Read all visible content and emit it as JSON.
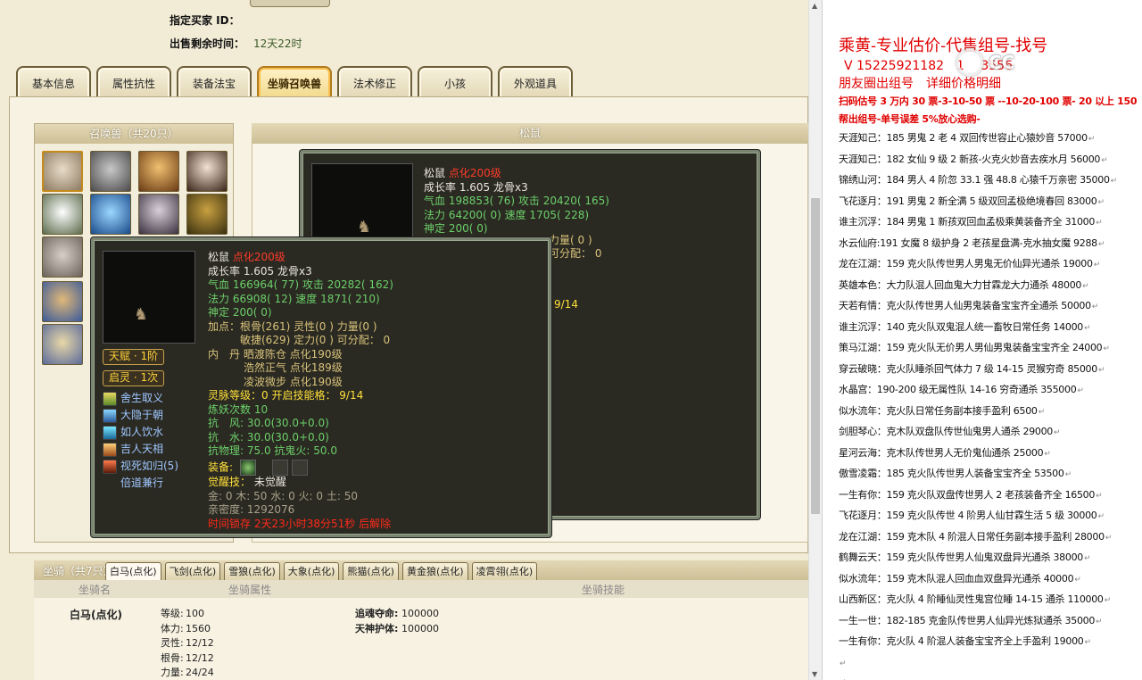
{
  "top_info": {
    "buyer_label": "指定买家 ID：",
    "time_label": "出售剩余时间：",
    "time_value": "12天22时"
  },
  "tabs": [
    "基本信息",
    "属性抗性",
    "装备法宝",
    "坐骑召唤兽",
    "法术修正",
    "小孩",
    "外观道具"
  ],
  "active_tab": "坐骑召唤兽",
  "pets_panel": {
    "title": "召唤兽（共20只）"
  },
  "right_panel": {
    "title": "松鼠"
  },
  "back_tooltip": {
    "name": "松鼠",
    "tag": "点化200级",
    "growth": "成长率 1.605  龙骨x3",
    "hp": "气血 198853( 76) 攻击 20420( 165)",
    "mp": "法力 64200( 0) 速度 1705( 228)",
    "spirit": "神定 200( 0)",
    "points_partial": "力量( 0 )",
    "free_partial": "可分配： 0",
    "frag1": "9/14"
  },
  "tooltip": {
    "name": "松鼠",
    "tag": "点化200级",
    "growth": "成长率 1.605  龙骨x3",
    "hp": "气血 166964( 77) 攻击 20282( 162)",
    "mp": "法力 66908( 12) 速度 1871( 210)",
    "spirit": "神定 200( 0)",
    "points1": "加点：根骨(261) 灵性(0 ) 力量(0 )",
    "points2": "敏捷(629) 定力(0 ) 可分配： 0",
    "dan_label": "内　丹",
    "dan1": "晒渡陈仓 点化190级",
    "dan2": "浩然正气 点化189级",
    "dan3": "凌波微步 点化190级",
    "soul_grade": "灵脉等级：0 开启技能格： 9/14",
    "train": "炼妖次数 10",
    "res_wind": "抗　风: 30.0(30.0+0.0)",
    "res_water": "抗　水: 30.0(30.0+0.0)",
    "res_phys": "抗物理: 75.0 抗鬼火: 50.0",
    "equip_label": "装备:",
    "awaken_label": "觉醒技：",
    "awaken_value": "未觉醒",
    "elements": "金: 0 木: 50 水: 0 火: 0 土: 50",
    "intimacy": "亲密度: 1292076",
    "lock_time": "时间锁存 2天23小时38分51秒 后解除",
    "badge1": "天赋 · 1阶",
    "badge2": "启灵 · 1次",
    "skills": [
      "舍生取义",
      "大隐于朝",
      "如人饮水",
      "吉人天相",
      "视死如归(5)",
      "倍道兼行"
    ]
  },
  "mount": {
    "title": "坐骑（共7只）",
    "tabs": [
      "白马(点化)",
      "飞剑(点化)",
      "雪狼(点化)",
      "大象(点化)",
      "熊猫(点化)",
      "黄金狼(点化)",
      "凌霄翎(点化)"
    ],
    "col_name": "坐骑名",
    "col_attr": "坐骑属性",
    "col_skill": "坐骑技能",
    "name": "白马(点化)",
    "attrs": [
      {
        "k": "等级:",
        "v": "100"
      },
      {
        "k": "体力:",
        "v": "1560"
      },
      {
        "k": "灵性:",
        "v": "12/12"
      },
      {
        "k": "根骨:",
        "v": "12/12"
      },
      {
        "k": "力量:",
        "v": "24/24"
      }
    ],
    "skills": [
      {
        "k": "追魂夺命:",
        "v": "100000"
      },
      {
        "k": "天神护体:",
        "v": "100000"
      }
    ]
  },
  "doc": {
    "title": "乘黄-专业估价-代售组号-找号",
    "phone": "V 15225921182　1　 3556",
    "sub": "朋友圈出组号　详细价格明细",
    "price1": "扫码估号 3 万内 30 票-3-10-50 票 --10-20-100 票- 20 以上 150",
    "price2": "帮出组号-单号误差 5%放心选购-",
    "lines": [
      "天涯知己：185 男鬼 2 老 4 双回传世容止心猿妙音 57000",
      "天涯知己：182 女仙 9 级 2 新孩-火克火妙音去疾水月 56000",
      "锦绣山河：184 男人 4 阶忽 33.1 强 48.8 心猿千万亲密 35000",
      "飞花逐月：191 男鬼 2 新全满 5 级双回孟极绝境春回 83000",
      "谁主沉浮：184 男鬼 1 新孩双回血孟极乘黄装备齐全 31000",
      "水云仙府:191 女魔 8 级护身 2 老孩星盘满-克水抽女魔 9288",
      "龙在江湖：159 克火队传世男人男鬼无价仙异光通杀 19000",
      "英雄本色：大力队混人回血鬼大力甘霖龙大力通杀 48000",
      "天若有情：克火队传世男人仙男鬼装备宝宝齐全通杀 50000",
      "谁主沉浮：140 克火队双鬼混人统一畜牧日常任务 14000",
      "策马江湖：159 克火队无价男人男仙男鬼装备宝宝齐全 24000",
      "穿云破晓：克火队睡杀回气体力 7 级 14-15 灵猴穷奇 85000",
      "水晶宫：190-200 级无属性队 14-16 穷奇通杀 355000",
      "似水流年：克火队日常任务副本接手盈利 6500",
      "剑胆琴心：克木队双盘队传世仙鬼男人通杀 29000",
      "星河云海：克木队传世男人无价鬼仙通杀 25000",
      "傲雪凌霜：185 克火队传世男人装备宝宝齐全 53500",
      "一生有你：159 克火队双盘传世男人 2 老孩装备齐全 16500",
      "飞花逐月：159 克火队传世 4 阶男人仙甘霖生活 5 级 30000",
      "龙在江湖：159 克木队 4 阶混人日常任务副本接手盈利 28000",
      "鹤舞云天：159 克火队传世男人仙鬼双盘异光通杀 38000",
      "似水流年：159 克木队混人回血血双盘异光通杀 40000",
      "山西新区：克火队 4 阶睡仙灵性鬼宫位睡 14-15 通杀 110000",
      "一生一世：182-185 克金队传世男人仙异光炼狱通杀 35000",
      "一生有你：克火队 4 阶混人装备宝宝齐全上手盈利 19000"
    ]
  },
  "colors": {
    "page_bg": "#f2ecd6",
    "tooltip_bg": "#2a2922",
    "accent_red": "#e00000",
    "stat_green": "#6dd06a",
    "tab_active": "#f2d98c"
  }
}
